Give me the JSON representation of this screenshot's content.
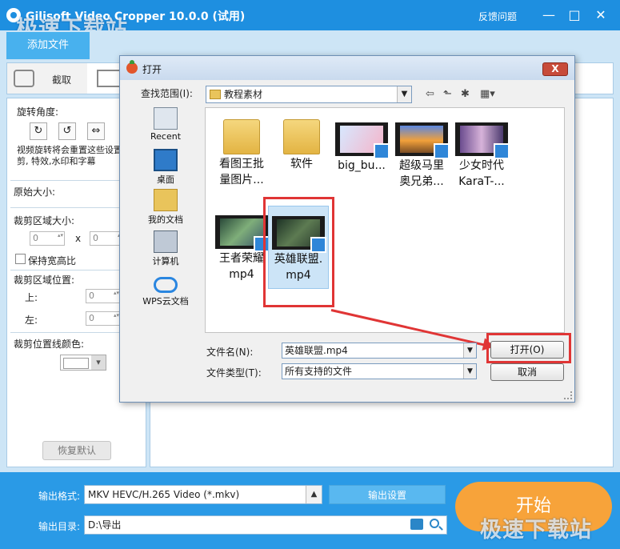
{
  "app": {
    "title": "Gilisoft Video Cropper 10.0.0 (试用)",
    "feedback": "反馈问题",
    "minimize": "—",
    "maximize": "□",
    "close": "✕",
    "watermark": "极速下载站"
  },
  "toolbar": {
    "add_file": "添加文件",
    "crop_tab": "截取"
  },
  "left_panel": {
    "rotate_label": "旋转角度:",
    "rotate_hint": "视频旋转将会重置这些设置:裁剪, 特效,水印和字幕",
    "original_size": "原始大小:",
    "crop_size": "裁剪区域大小:",
    "width_value": "0",
    "x_sep": "x",
    "height_value": "0",
    "keep_ratio": "保持宽高比",
    "crop_position": "裁剪区域位置:",
    "top_label": "上:",
    "top_value": "0",
    "left_label": "左:",
    "left_value": "0",
    "line_color": "裁剪位置线颜色:",
    "restore_default": "恢复默认"
  },
  "bottom": {
    "format_label": "输出格式:",
    "format_value": "MKV HEVC/H.265 Video (*.mkv)",
    "output_settings": "输出设置",
    "dir_label": "输出目录:",
    "dir_value": "D:\\导出",
    "start": "开始"
  },
  "dialog": {
    "title": "打开",
    "close": "X",
    "look_in_label": "查找范围(I):",
    "look_in_value": "教程素材",
    "places": [
      {
        "label": "Recent"
      },
      {
        "label": "桌面"
      },
      {
        "label": "我的文档"
      },
      {
        "label": "计算机"
      },
      {
        "label": "WPS云文档"
      }
    ],
    "files": [
      {
        "line1": "看图王批",
        "line2": "量图片..."
      },
      {
        "line1": "软件",
        "line2": ""
      },
      {
        "line1": "big_bu...",
        "line2": ""
      },
      {
        "line1": "超级马里",
        "line2": "奥兄弟..."
      },
      {
        "line1": "少女时代",
        "line2": "KaraT-..."
      },
      {
        "line1": "王者荣耀",
        "line2": "mp4"
      },
      {
        "line1": "英雄联盟.",
        "line2": "mp4"
      }
    ],
    "filename_label": "文件名(N):",
    "filename_value": "英雄联盟.mp4",
    "filetype_label": "文件类型(T):",
    "filetype_value": "所有支持的文件",
    "open_button": "打开(O)",
    "cancel_button": "取消"
  },
  "colors": {
    "accent": "#1e8fe0",
    "start_button": "#f7a33a",
    "highlight": "#e03535"
  }
}
